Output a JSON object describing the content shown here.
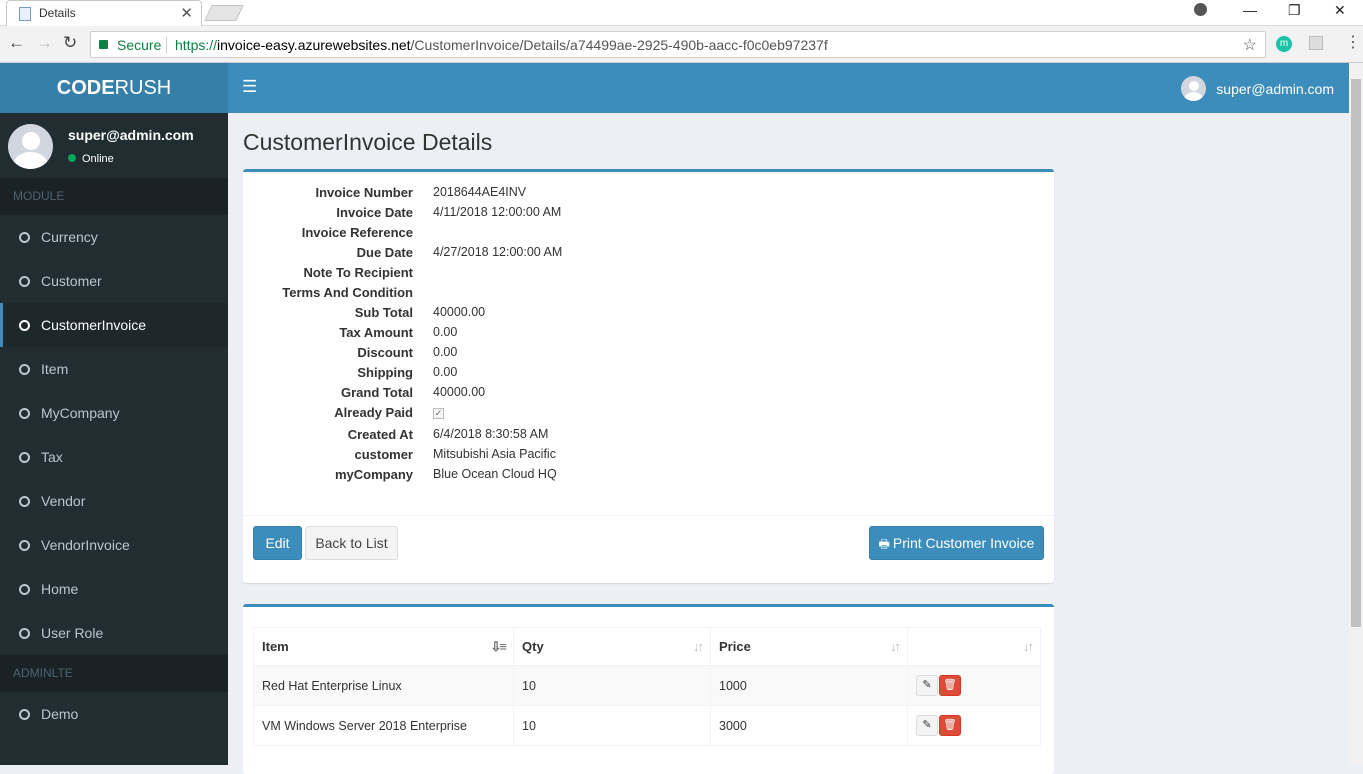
{
  "browser": {
    "tab_title": "Details",
    "secure_label": "Secure",
    "url_proto": "https://",
    "url_host": "invoice-easy.azurewebsites.net",
    "url_path": "/CustomerInvoice/Details/a74499ae-2925-490b-aacc-f0c0eb97237f"
  },
  "header": {
    "logo_bold": "CODE",
    "logo_light": "RUSH",
    "user_email": "super@admin.com"
  },
  "sidebar": {
    "user_name": "super@admin.com",
    "user_status": "Online",
    "section_module": "MODULE",
    "items": [
      {
        "label": "Currency"
      },
      {
        "label": "Customer"
      },
      {
        "label": "CustomerInvoice"
      },
      {
        "label": "Item"
      },
      {
        "label": "MyCompany"
      },
      {
        "label": "Tax"
      },
      {
        "label": "Vendor"
      },
      {
        "label": "VendorInvoice"
      },
      {
        "label": "Home"
      },
      {
        "label": "User Role"
      }
    ],
    "section_adminlte": "ADMINLTE",
    "demo_label": "Demo"
  },
  "main": {
    "title": "CustomerInvoice Details",
    "fields": [
      {
        "label": "Invoice Number",
        "value": "2018644AE4INV"
      },
      {
        "label": "Invoice Date",
        "value": "4/11/2018 12:00:00 AM"
      },
      {
        "label": "Invoice Reference",
        "value": ""
      },
      {
        "label": "Due Date",
        "value": "4/27/2018 12:00:00 AM"
      },
      {
        "label": "Note To Recipient",
        "value": ""
      },
      {
        "label": "Terms And Condition",
        "value": ""
      },
      {
        "label": "Sub Total",
        "value": "40000.00"
      },
      {
        "label": "Tax Amount",
        "value": "0.00"
      },
      {
        "label": "Discount",
        "value": "0.00"
      },
      {
        "label": "Shipping",
        "value": "0.00"
      },
      {
        "label": "Grand Total",
        "value": "40000.00"
      },
      {
        "label": "Already Paid",
        "value": ""
      },
      {
        "label": "Created At",
        "value": "6/4/2018 8:30:58 AM"
      },
      {
        "label": "customer",
        "value": "Mitsubishi Asia Pacific"
      },
      {
        "label": "myCompany",
        "value": "Blue Ocean Cloud HQ"
      }
    ],
    "already_paid_checked": true,
    "buttons": {
      "edit": "Edit",
      "back": "Back to List",
      "print": "Print Customer Invoice"
    },
    "table": {
      "columns": [
        "Item",
        "Qty",
        "Price",
        ""
      ],
      "rows": [
        {
          "item": "Red Hat Enterprise Linux",
          "qty": "10",
          "price": "1000"
        },
        {
          "item": "VM Windows Server 2018 Enterprise",
          "qty": "10",
          "price": "3000"
        }
      ]
    }
  },
  "colors": {
    "brand": "#3c8dbc",
    "logo_bg": "#367fa9",
    "sidebar_bg": "#222d32",
    "danger": "#dd4b39"
  }
}
